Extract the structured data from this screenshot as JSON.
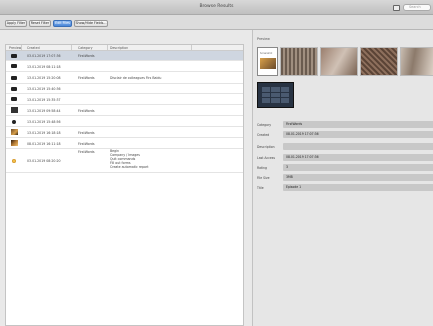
{
  "window": {
    "title": "Browse Results",
    "search_placeholder": "Search"
  },
  "toolbar": {
    "buttons": [
      {
        "label": "Apply Filter",
        "active": false
      },
      {
        "label": "Reset Filter",
        "active": false
      },
      {
        "label": "Edit Files",
        "active": true
      },
      {
        "label": "Show/Hide Fields...",
        "active": false
      }
    ]
  },
  "columns": [
    "Preview",
    "Created",
    "Category",
    "Description"
  ],
  "rows": [
    {
      "thumb": "camera",
      "created": "03.01.2019 17:07:36",
      "category": "FirstWords",
      "description": "",
      "selected": true
    },
    {
      "thumb": "camera",
      "created": "13.01.2019 08:11:18",
      "category": "",
      "description": ""
    },
    {
      "thumb": "camera",
      "created": "13.01.2019 15:20:08",
      "category": "FirstWords",
      "description": "Disclair de colleagues Firs Baidu"
    },
    {
      "thumb": "camera",
      "created": "13.01.2019 15:40:36",
      "category": "",
      "description": ""
    },
    {
      "thumb": "camera",
      "created": "13.01.2019 15:35:37",
      "category": "",
      "description": ""
    },
    {
      "thumb": "dark",
      "created": "13.01.2019 09:58:44",
      "category": "FirstWords",
      "description": ""
    },
    {
      "thumb": "camera",
      "created": "13.01.2019 15:48:56",
      "category": "",
      "description": ""
    },
    {
      "thumb": "photo1",
      "created": "13.01.2019 16:18:18",
      "category": "FirstWords",
      "description": ""
    },
    {
      "thumb": "photo2",
      "created": "08.01.2019 16:11:18",
      "category": "FirstWords",
      "description": ""
    },
    {
      "thumb": "photo3",
      "created": "03.01.2019 08:20:20",
      "category": "FirstWords",
      "description": "",
      "notes": [
        "Begin",
        "Company / Images",
        "Quit commands",
        "Fill out forms",
        "Create automatic report"
      ]
    }
  ],
  "preview": {
    "label": "Preview",
    "thumb_caption": "Screenshot"
  },
  "properties": [
    {
      "label": "Category",
      "value": "FirstWords"
    },
    {
      "label": "Created",
      "value": "08.01.2019 17:07:36"
    },
    {
      "label": "Description",
      "value": ""
    },
    {
      "label": "Last Access",
      "value": "08.01.2019 17:07:36"
    },
    {
      "label": "Rating",
      "value": "3"
    },
    {
      "label": "File Size",
      "value": "3MB"
    },
    {
      "label": "Title",
      "value": "Episode 1"
    }
  ]
}
